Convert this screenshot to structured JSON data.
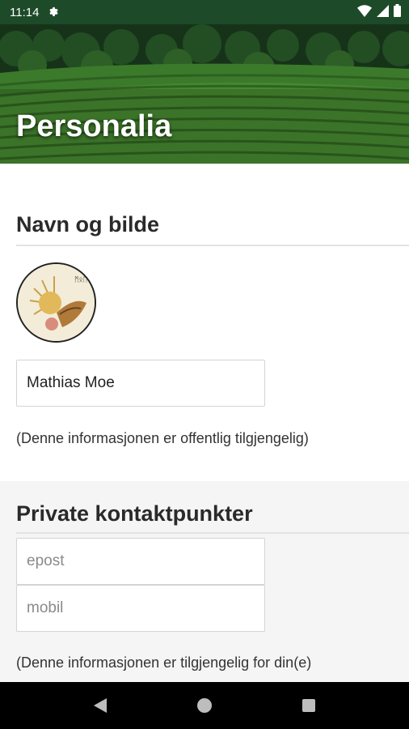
{
  "status_bar": {
    "time": "11:14"
  },
  "header": {
    "title": "Personalia"
  },
  "section_name": {
    "title": "Navn og bilde",
    "name_value": "Mathias Moe",
    "info": "(Denne informasjonen er offentlig tilgjengelig)"
  },
  "section_contact": {
    "title": "Private kontaktpunkter",
    "email_placeholder": "epost",
    "mobile_placeholder": "mobil",
    "info": "(Denne informasjonen er tilgjengelig for din(e)"
  },
  "colors": {
    "status_bar": "#1d4a28",
    "nav_bar": "#000000"
  },
  "icons": [
    "gear-icon",
    "wifi-icon",
    "signal-icon",
    "battery-icon",
    "back-icon",
    "home-icon",
    "recents-icon"
  ]
}
